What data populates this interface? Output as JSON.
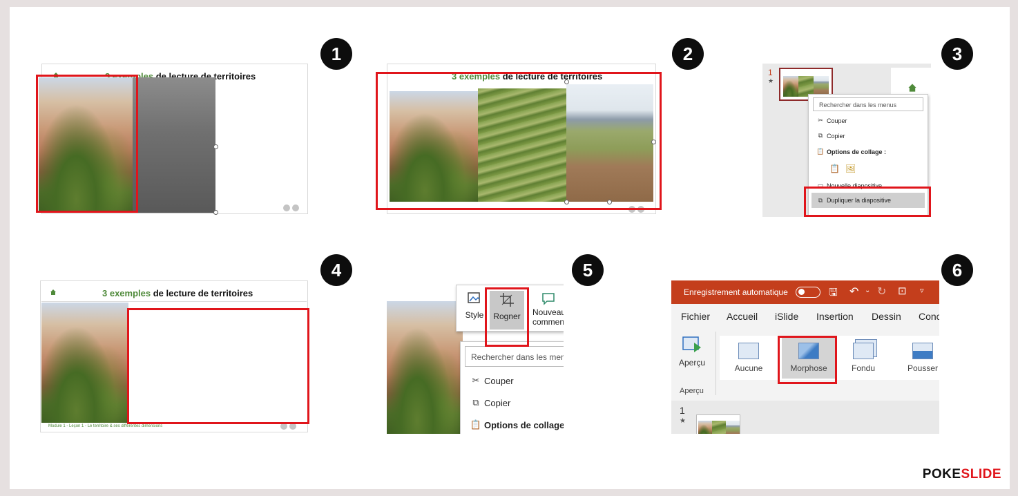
{
  "slide": {
    "title_highlight": "3 exemples",
    "title_rest": "de lecture de territoires",
    "footer": "Module 1 - Leçon 1 - Le territoire & ses différentes dimensions"
  },
  "steps": {
    "s1": "1",
    "s2": "2",
    "s3": "3",
    "s4": "4",
    "s5": "5",
    "s6": "6"
  },
  "context_menu": {
    "slide_number": "1",
    "search_placeholder": "Rechercher dans les menus",
    "cut": "Couper",
    "copy": "Copier",
    "paste_options": "Options de collage :",
    "new_slide": "Nouvelle diapositive",
    "duplicate": "Dupliquer la diapositive"
  },
  "crop_toolbar": {
    "style": "Style",
    "crop": "Rogner",
    "new_comment_line1": "Nouveau",
    "new_comment_line2": "commentaire",
    "search_placeholder": "Rechercher dans les menus",
    "cut": "Couper",
    "copy": "Copier",
    "paste_options": "Options de collage"
  },
  "ribbon": {
    "autosave": "Enregistrement automatique",
    "tabs": [
      "Fichier",
      "Accueil",
      "iSlide",
      "Insertion",
      "Dessin",
      "Conception"
    ],
    "preview": "Aperçu",
    "preview_group": "Aperçu",
    "transitions": [
      "Aucune",
      "Morphose",
      "Fondu",
      "Pousser"
    ],
    "slide_number": "1",
    "accent": "#c43e1c"
  },
  "brand": {
    "logo": "POKESLIDE",
    "logo_part1": "POKE",
    "logo_part2": "SLIDE"
  },
  "colors": {
    "highlight_box": "#e0151b",
    "title_green": "#4f8a3a"
  }
}
